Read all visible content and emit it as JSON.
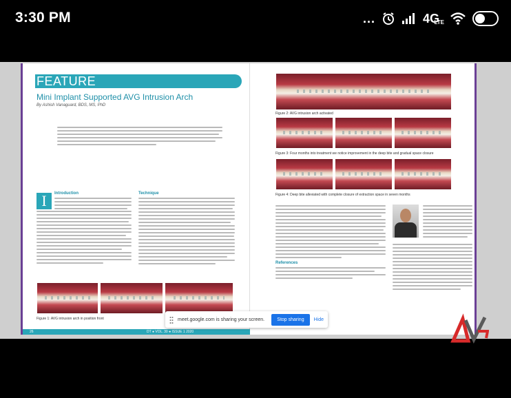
{
  "status_bar": {
    "time": "3:30 PM",
    "dots": "...",
    "network": "4G",
    "network_sub": "LTE",
    "icons": [
      "alarm-icon",
      "signal-icon",
      "wifi-icon",
      "toggle-icon"
    ]
  },
  "document": {
    "section_label": "FEATURE",
    "title": "Mini Implant Supported AVG Intrusion Arch",
    "byline": "By Ashish Vanaguard, BDS, MS, PhD",
    "drop_cap": "I",
    "col1_heading": "Introduction",
    "col2_heading": "Technique",
    "refs_heading": "References",
    "fig1_caption": "Figure 1: AVG intrusion arch in position front",
    "fig2_caption": "Figure 2: AVG intrusion arch activated",
    "fig3_caption": "Figure 3: Four months into treatment we notice improvement in the deep bite and gradual space closure",
    "fig4_caption": "Figure 4: Deep bite alleviated with complete closure of extraction space in seven months",
    "footer_page": "26",
    "footer_issue": "DT ● VOL. 30 ● ISSUE 1 2020"
  },
  "share_banner": {
    "text": "meet.google.com is sharing your screen.",
    "stop_label": "Stop sharing",
    "hide_label": "Hide"
  },
  "colors": {
    "accent": "#2aa6b8",
    "border": "#6a3f95",
    "button": "#1a73e8"
  }
}
